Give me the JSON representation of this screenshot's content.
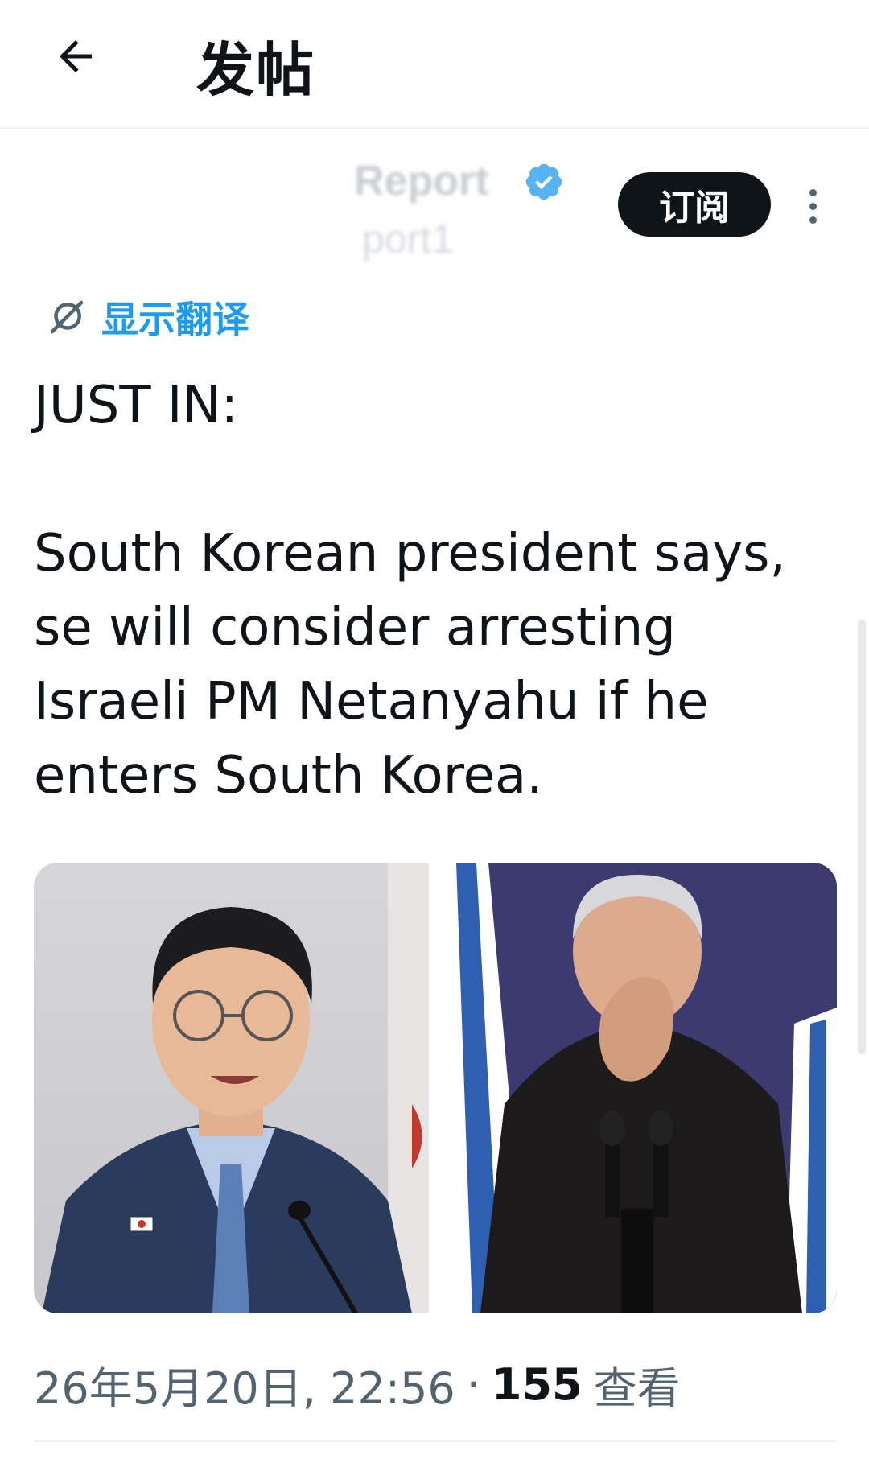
{
  "header": {
    "title": "发帖",
    "back_icon": "arrow-left-icon"
  },
  "post": {
    "author_name": "Report",
    "author_handle": "port1",
    "verified_icon": "verified-badge-icon",
    "subscribe_label": "订阅",
    "more_icon": "more-vertical-icon",
    "translate_label": "显示翻译",
    "translate_icon": "translate-slash-icon",
    "text_heading": "JUST IN:",
    "text_body": "South Korean president says, se will consider arresting Israeli PM Netanyahu if he enters South Korea.",
    "images": [
      {
        "alt": "South Korean president speaking"
      },
      {
        "alt": "Israeli PM Netanyahu"
      }
    ],
    "timestamp": "26年5月20日, 22:56",
    "separator": "·",
    "views_count": "155",
    "views_label": "查看"
  },
  "colors": {
    "accent": "#1d9bf0",
    "text": "#0f1419",
    "muted": "#536471",
    "button_bg": "#0f1419"
  }
}
